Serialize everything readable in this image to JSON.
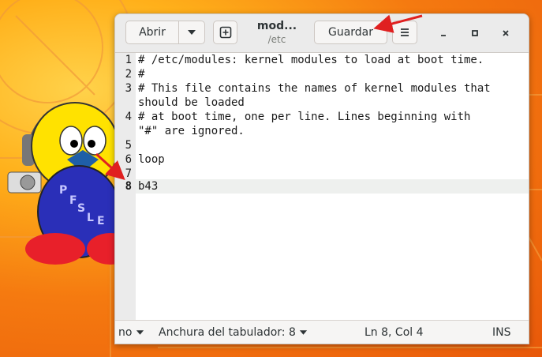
{
  "window": {
    "title": "mod...",
    "subtitle": "/etc"
  },
  "header": {
    "open_label": "Abrir",
    "save_label": "Guardar"
  },
  "editor": {
    "lines": [
      {
        "num": "1",
        "text": "# /etc/modules: kernel modules to load at boot time."
      },
      {
        "num": "2",
        "text": "#"
      },
      {
        "num": "3",
        "text": "# This file contains the names of kernel modules that"
      },
      {
        "num": "",
        "text": "should be loaded"
      },
      {
        "num": "4",
        "text": "# at boot time, one per line. Lines beginning with"
      },
      {
        "num": "",
        "text": "\"#\" are ignored."
      },
      {
        "num": "5",
        "text": ""
      },
      {
        "num": "6",
        "text": "loop"
      },
      {
        "num": "7",
        "text": ""
      },
      {
        "num": "8",
        "text": "b43"
      }
    ],
    "current_line": 8
  },
  "statusbar": {
    "language": "no",
    "tab_width": "Anchura del tabulador: 8",
    "position": "Ln 8, Col 4",
    "mode": "INS"
  },
  "background": {
    "penguin_letters": [
      "P",
      "F",
      "S",
      "L",
      "E"
    ]
  },
  "colors": {
    "annotation_arrow": "#e02020",
    "background_orange": "#f57a10"
  }
}
